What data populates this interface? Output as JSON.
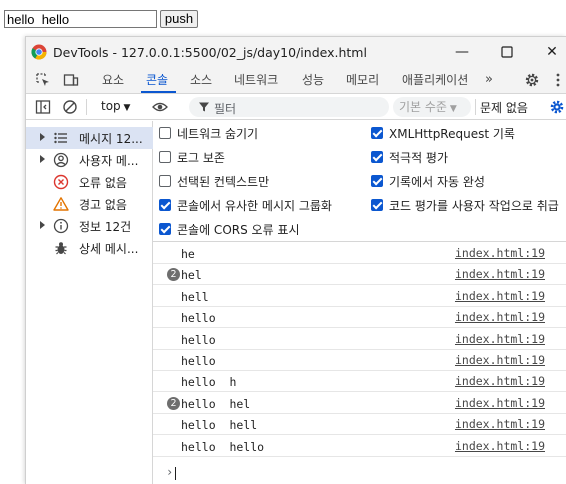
{
  "page": {
    "input_value": "hello  hello",
    "push_label": "push"
  },
  "window": {
    "title": "DevTools - 127.0.0.1:5500/02_js/day10/index.html",
    "minimize": "—",
    "close": "✕"
  },
  "tabs": [
    {
      "label": "요소"
    },
    {
      "label": "콘솔"
    },
    {
      "label": "소스"
    },
    {
      "label": "네트워크"
    },
    {
      "label": "성능"
    },
    {
      "label": "메모리"
    },
    {
      "label": "애플리케이션"
    }
  ],
  "toolbar": {
    "context": "top",
    "filter_placeholder": "필터",
    "level": "기본 수준",
    "issues": "문제 없음"
  },
  "sidebar": [
    {
      "label": "메시지 12..."
    },
    {
      "label": "사용자 메..."
    },
    {
      "label": "오류 없음"
    },
    {
      "label": "경고 없음"
    },
    {
      "label": "정보 12건"
    },
    {
      "label": "상세 메시..."
    }
  ],
  "settings": {
    "left": [
      {
        "label": "네트워크 숨기기",
        "checked": false
      },
      {
        "label": "로그 보존",
        "checked": false
      },
      {
        "label": "선택된 컨텍스트만",
        "checked": false
      },
      {
        "label": "콘솔에서 유사한 메시지 그룹화",
        "checked": true
      },
      {
        "label": "콘솔에 CORS 오류 표시",
        "checked": true
      }
    ],
    "right": [
      {
        "label": "XMLHttpRequest 기록",
        "checked": true
      },
      {
        "label": "적극적 평가",
        "checked": true
      },
      {
        "label": "기록에서 자동 완성",
        "checked": true
      },
      {
        "label": "코드 평가를 사용자 작업으로 취급",
        "checked": true
      }
    ]
  },
  "logs": [
    {
      "msg": "he",
      "badge": "",
      "src": "index.html:19"
    },
    {
      "msg": "hel",
      "badge": "2",
      "src": "index.html:19"
    },
    {
      "msg": "hell",
      "badge": "",
      "src": "index.html:19"
    },
    {
      "msg": "hello",
      "badge": "",
      "src": "index.html:19"
    },
    {
      "msg": "hello",
      "badge": "",
      "src": "index.html:19"
    },
    {
      "msg": "hello",
      "badge": "",
      "src": "index.html:19"
    },
    {
      "msg": "hello  h",
      "badge": "",
      "src": "index.html:19"
    },
    {
      "msg": "hello  hel",
      "badge": "2",
      "src": "index.html:19"
    },
    {
      "msg": "hello  hell",
      "badge": "",
      "src": "index.html:19"
    },
    {
      "msg": "hello  hello",
      "badge": "",
      "src": "index.html:19"
    }
  ],
  "prompt": "›",
  "colors": {
    "accent": "#0b57d0",
    "selected": "#dbe3f3"
  }
}
